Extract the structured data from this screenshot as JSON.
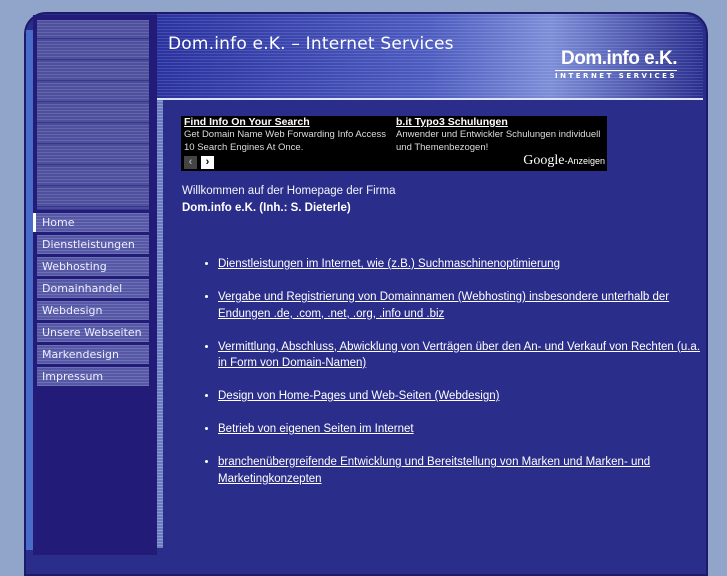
{
  "header": {
    "title": "Dom.info e.K. – Internet Services",
    "logo_main": "Dom.info e.K.",
    "logo_sub": "INTERNET SERVICES"
  },
  "nav": [
    {
      "label": "Home"
    },
    {
      "label": "Dienstleistungen"
    },
    {
      "label": "Webhosting"
    },
    {
      "label": "Domainhandel"
    },
    {
      "label": "Webdesign"
    },
    {
      "label": "Unsere Webseiten"
    },
    {
      "label": "Markendesign"
    },
    {
      "label": "Impressum"
    }
  ],
  "ads": {
    "items": [
      {
        "title": "Find Info On Your Search",
        "text": "Get Domain Name Web Forwarding Info Access 10 Search Engines At Once."
      },
      {
        "title": "b.it Typo3 Schulungen",
        "text": "Anwender und Entwickler Schulungen individuell und Themenbezogen!"
      }
    ],
    "prev": "‹",
    "next": "›",
    "google": "Google",
    "anzeigen": "-Anzeigen"
  },
  "welcome": {
    "line1": "Willkommen auf der Homepage der Firma",
    "line2": "Dom.info e.K. (Inh.: S. Dieterle)"
  },
  "services": [
    "Dienstleistungen im Internet, wie (z.B.) Suchmaschinenoptimierung",
    "Vergabe und Registrierung von Domainnamen (Webhosting) insbesondere unterhalb der Endungen .de, .com, .net, .org, .info und .biz",
    "Vermittlung, Abschluss, Abwicklung von Verträgen über den An- und Verkauf von Rechten (u.a. in Form von Domain-Namen)",
    "Design von Home-Pages und Web-Seiten (Webdesign)",
    "Betrieb von eigenen Seiten im Internet",
    "branchenübergreifende Entwicklung und Bereitstellung von Marken und Marken- und Marketingkonzepten"
  ]
}
